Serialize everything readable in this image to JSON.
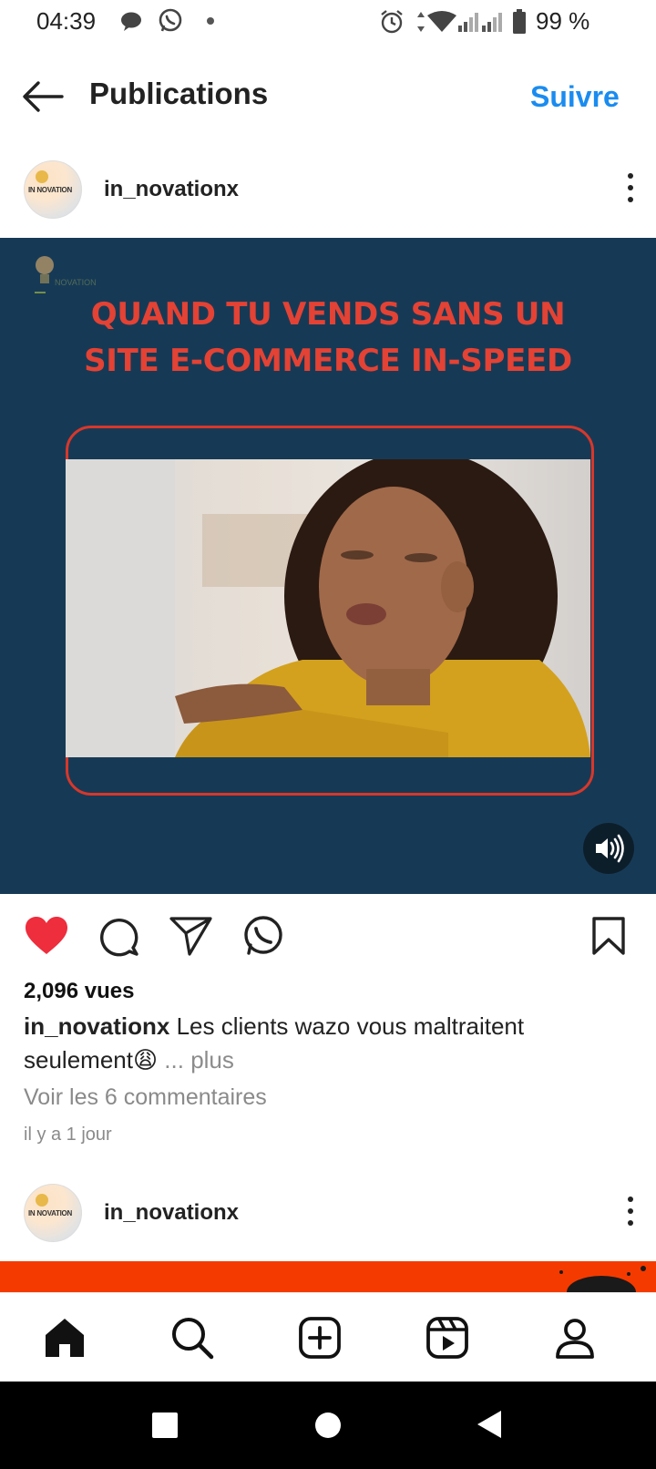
{
  "status_bar": {
    "time": "04:39",
    "battery": "99 %",
    "icons": [
      "chat-bubble-icon",
      "whatsapp-icon",
      "dot-icon",
      "alarm-icon",
      "data-arrows-icon",
      "wifi-icon",
      "signal-icon",
      "signal-icon",
      "battery-icon"
    ]
  },
  "header": {
    "title": "Publications",
    "follow_label": "Suivre",
    "back_icon": "arrow-left-icon"
  },
  "post": {
    "username": "in_novationx",
    "avatar_text": "IN NOVATION",
    "media": {
      "logo_text": "NOVATION",
      "overlay_line1": "QUAND TU VENDS SANS UN",
      "overlay_line2": "SITE E-COMMERCE IN-SPEED",
      "volume_icon": "volume-icon"
    },
    "actions": {
      "like_icon": "heart-filled-icon",
      "comment_icon": "comment-icon",
      "share_icon": "send-icon",
      "whatsapp_icon": "whatsapp-icon",
      "save_icon": "bookmark-icon"
    },
    "views": "2,096 vues",
    "caption_user": "in_novationx",
    "caption_text": " Les clients wazo vous maltraitent seulement",
    "caption_emoji": "😩",
    "caption_more": " ... plus",
    "comments_link": "Voir les 6 commentaires",
    "time_ago": "il y a 1 jour"
  },
  "next_post": {
    "username": "in_novationx",
    "avatar_text": "IN NOVATION"
  },
  "bottom_nav": {
    "items": [
      "home-icon",
      "search-icon",
      "create-icon",
      "reels-icon",
      "profile-icon"
    ]
  },
  "android_nav": {
    "items": [
      "recents-icon",
      "home-circle-icon",
      "back-triangle-icon"
    ]
  },
  "colors": {
    "accent": "#1a8cf0",
    "like": "#ee2d3d",
    "media_bg": "#163a56",
    "overlay_text": "#e34234",
    "next_post_strip": "#f53a00"
  }
}
